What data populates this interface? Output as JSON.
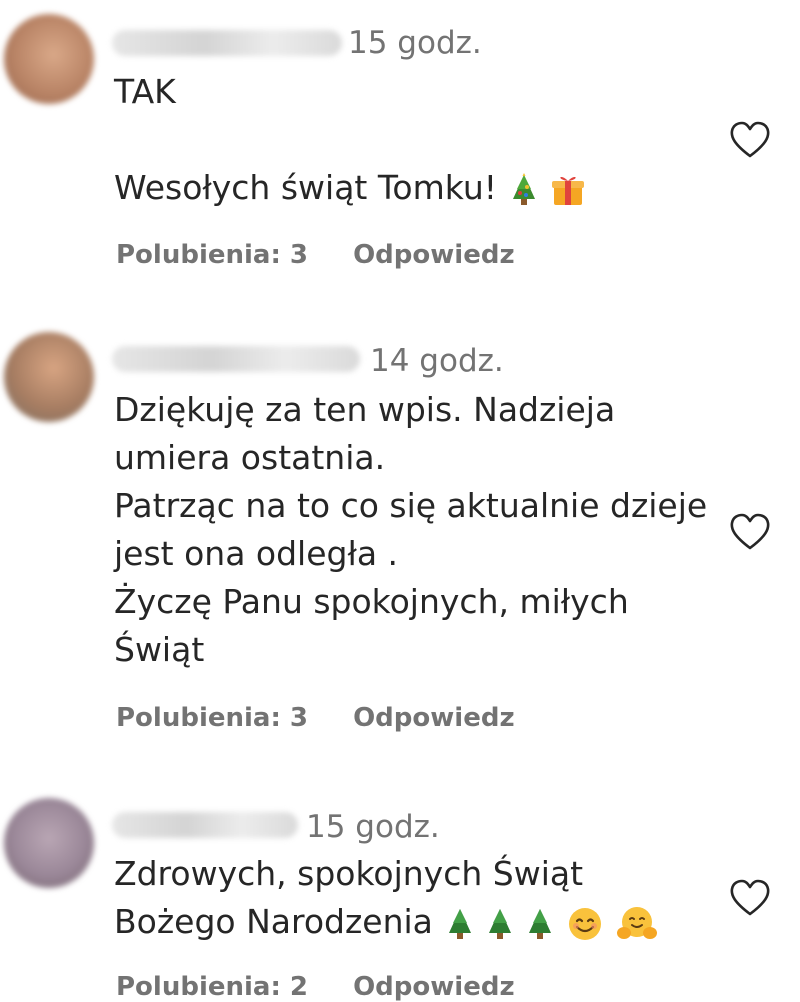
{
  "comments": [
    {
      "time": "15 godz.",
      "lines": [
        "TAK",
        "",
        "Wesołych świąt Tomku!"
      ],
      "likes": "Polubienia: 3",
      "reply": "Odpowiedz"
    },
    {
      "time": "14 godz.",
      "lines": [
        "Dziękuję za ten wpis. Nadzieja",
        "umiera ostatnia.",
        "Patrząc na to co się aktualnie dzieje",
        "jest ona odległa .",
        "Życzę Panu spokojnych, miłych",
        "Świąt"
      ],
      "likes": "Polubienia: 3",
      "reply": "Odpowiedz"
    },
    {
      "time": "15 godz.",
      "lines": [
        "Zdrowych, spokojnych Świąt",
        "Bożego Narodzenia"
      ],
      "likes": "Polubienia: 2",
      "reply": "Odpowiedz"
    }
  ],
  "icons": {
    "like": "heart-outline-icon",
    "tree": "christmas-tree-emoji",
    "gift": "gift-emoji",
    "smile": "smiling-face-emoji",
    "hug": "hugging-face-emoji"
  }
}
